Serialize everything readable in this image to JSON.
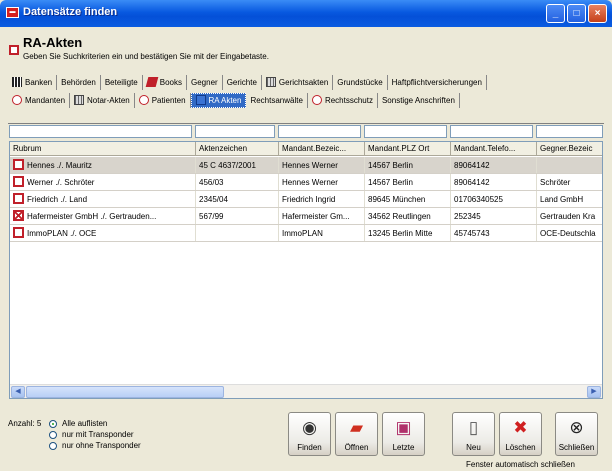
{
  "window": {
    "title": "Datensätze finden",
    "icon": "app-icon",
    "minimize": "_",
    "maximize": "□",
    "close": "×"
  },
  "header": {
    "title": "RA-Akten",
    "subtitle": "Geben Sie Suchkriterien ein und bestätigen Sie mit der Eingabetaste."
  },
  "tabs_row1": [
    {
      "label": "Banken",
      "icon": "ledger-icon"
    },
    {
      "label": "Behörden",
      "icon": ""
    },
    {
      "label": "Beteiligte",
      "icon": ""
    },
    {
      "label": "Books",
      "icon": "book-icon"
    },
    {
      "label": "Gegner",
      "icon": ""
    },
    {
      "label": "Gerichte",
      "icon": ""
    },
    {
      "label": "Gerichtsakten",
      "icon": "grid-icon"
    },
    {
      "label": "Grundstücke",
      "icon": ""
    },
    {
      "label": "Haftpflichtversicherungen",
      "icon": ""
    }
  ],
  "tabs_row2": [
    {
      "label": "Mandanten",
      "icon": "person-icon"
    },
    {
      "label": "Notar-Akten",
      "icon": "grid-icon"
    },
    {
      "label": "Patienten",
      "icon": "person-icon"
    },
    {
      "label": "RA Akten",
      "icon": "folder-icon",
      "active": true
    },
    {
      "label": "Rechtsanwälte",
      "icon": ""
    },
    {
      "label": "Rechtsschutz",
      "icon": "person-icon"
    },
    {
      "label": "Sonstige Anschriften",
      "icon": ""
    }
  ],
  "grid": {
    "columns": [
      "Rubrum",
      "Aktenzeichen",
      "Mandant.Bezeic...",
      "Mandant.PLZ Ort",
      "Mandant.Telefo...",
      "Gegner.Bezeic"
    ],
    "rows": [
      [
        "Hennes ./. Mauritz",
        "45 C 4637/2001",
        "Hennes Werner",
        "14567 Berlin",
        "89064142",
        ""
      ],
      [
        "Werner ./. Schröter",
        "456/03",
        "Hennes Werner",
        "14567 Berlin",
        "89064142",
        "Schröter"
      ],
      [
        "Friedrich ./. Land",
        "2345/04",
        "Friedrich Ingrid",
        "89645 München",
        "01706340525",
        "Land GmbH"
      ],
      [
        "Hafermeister GmbH ./. Gertrauden...",
        "567/99",
        "Hafermeister Gm...",
        "34562 Reutlingen",
        "252345",
        "Gertrauden Kra"
      ],
      [
        "ImmoPLAN ./. OCE",
        "",
        "ImmoPLAN",
        "13245 Berlin Mitte",
        "45745743",
        "OCE-Deutschla"
      ]
    ],
    "row_icons": [
      "record-icon",
      "record-icon",
      "record-icon",
      "record-x-icon",
      "record-icon"
    ],
    "selected_row": 0
  },
  "footer": {
    "count_label": "Anzahl: 5",
    "radios": [
      {
        "label": "Alle auflisten",
        "checked": true
      },
      {
        "label": "nur mit Transponder",
        "checked": false
      },
      {
        "label": "nur ohne Transponder",
        "checked": false
      }
    ],
    "buttons": [
      {
        "label": "Finden",
        "icon": "eye-icon"
      },
      {
        "label": "Öffnen",
        "icon": "open-folder-icon"
      },
      {
        "label": "Letzte",
        "icon": "last-icon"
      },
      {
        "label": "Neu",
        "icon": "new-document-icon"
      },
      {
        "label": "Löschen",
        "icon": "delete-icon"
      },
      {
        "label": "Schließen",
        "icon": "close-circle-icon"
      }
    ],
    "auto_close": "Fenster automatisch schließen"
  }
}
